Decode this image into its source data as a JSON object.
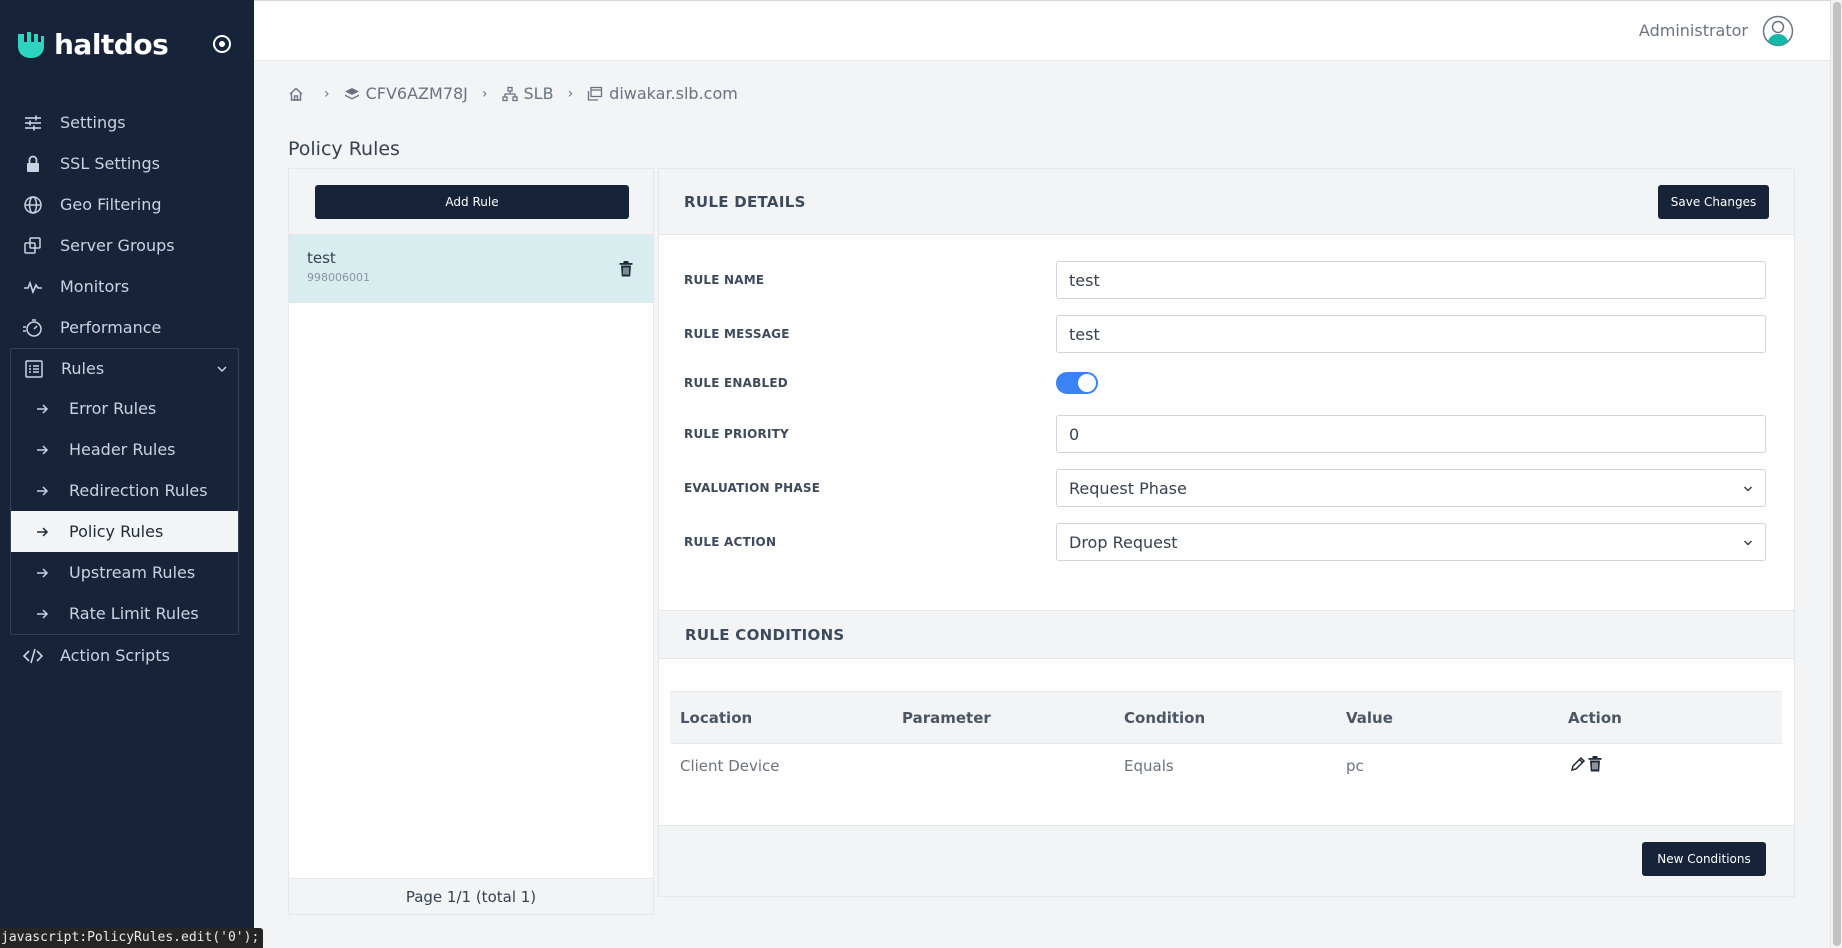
{
  "brand": {
    "name": "haltdos"
  },
  "sidebar": {
    "items": [
      {
        "label": "Settings",
        "icon": "sliders-icon"
      },
      {
        "label": "SSL Settings",
        "icon": "lock-icon"
      },
      {
        "label": "Geo Filtering",
        "icon": "globe-icon"
      },
      {
        "label": "Server Groups",
        "icon": "copy-icon"
      },
      {
        "label": "Monitors",
        "icon": "activity-icon"
      },
      {
        "label": "Performance",
        "icon": "timer-icon"
      }
    ],
    "rules": {
      "label": "Rules",
      "children": [
        {
          "label": "Error Rules"
        },
        {
          "label": "Header Rules"
        },
        {
          "label": "Redirection Rules"
        },
        {
          "label": "Policy Rules",
          "active": true
        },
        {
          "label": "Upstream Rules"
        },
        {
          "label": "Rate Limit Rules"
        }
      ]
    },
    "after": [
      {
        "label": "Action Scripts",
        "icon": "code-icon"
      }
    ]
  },
  "status_tip": "javascript:PolicyRules.edit('0');",
  "user": {
    "name": "Administrator"
  },
  "breadcrumb": {
    "items": [
      "CFV6AZM78J",
      "SLB",
      "diwakar.slb.com"
    ],
    "separator": "›"
  },
  "page": {
    "title": "Policy Rules"
  },
  "rules_list": {
    "add_label": "Add Rule",
    "items": [
      {
        "name": "test",
        "id": "998006001"
      }
    ],
    "pagination": "Page 1/1 (total 1)"
  },
  "details": {
    "title": "RULE DETAILS",
    "save_label": "Save Changes",
    "fields": {
      "rule_name": {
        "label": "RULE NAME",
        "value": "test"
      },
      "rule_message": {
        "label": "RULE MESSAGE",
        "value": "test"
      },
      "rule_enabled": {
        "label": "RULE ENABLED",
        "value": true
      },
      "rule_priority": {
        "label": "RULE PRIORITY",
        "value": "0"
      },
      "evaluation_phase": {
        "label": "EVALUATION PHASE",
        "value": "Request Phase"
      },
      "rule_action": {
        "label": "RULE ACTION",
        "value": "Drop Request"
      }
    }
  },
  "conditions": {
    "title": "RULE CONDITIONS",
    "columns": [
      "Location",
      "Parameter",
      "Condition",
      "Value",
      "Action"
    ],
    "rows": [
      {
        "location": "Client Device",
        "parameter": "",
        "condition": "Equals",
        "value": "pc"
      }
    ],
    "new_label": "New Conditions"
  },
  "colors": {
    "sidebar_bg": "#172339",
    "accent": "#3b82f6",
    "selected_row": "#d8eeee",
    "button_dark": "#172339"
  }
}
